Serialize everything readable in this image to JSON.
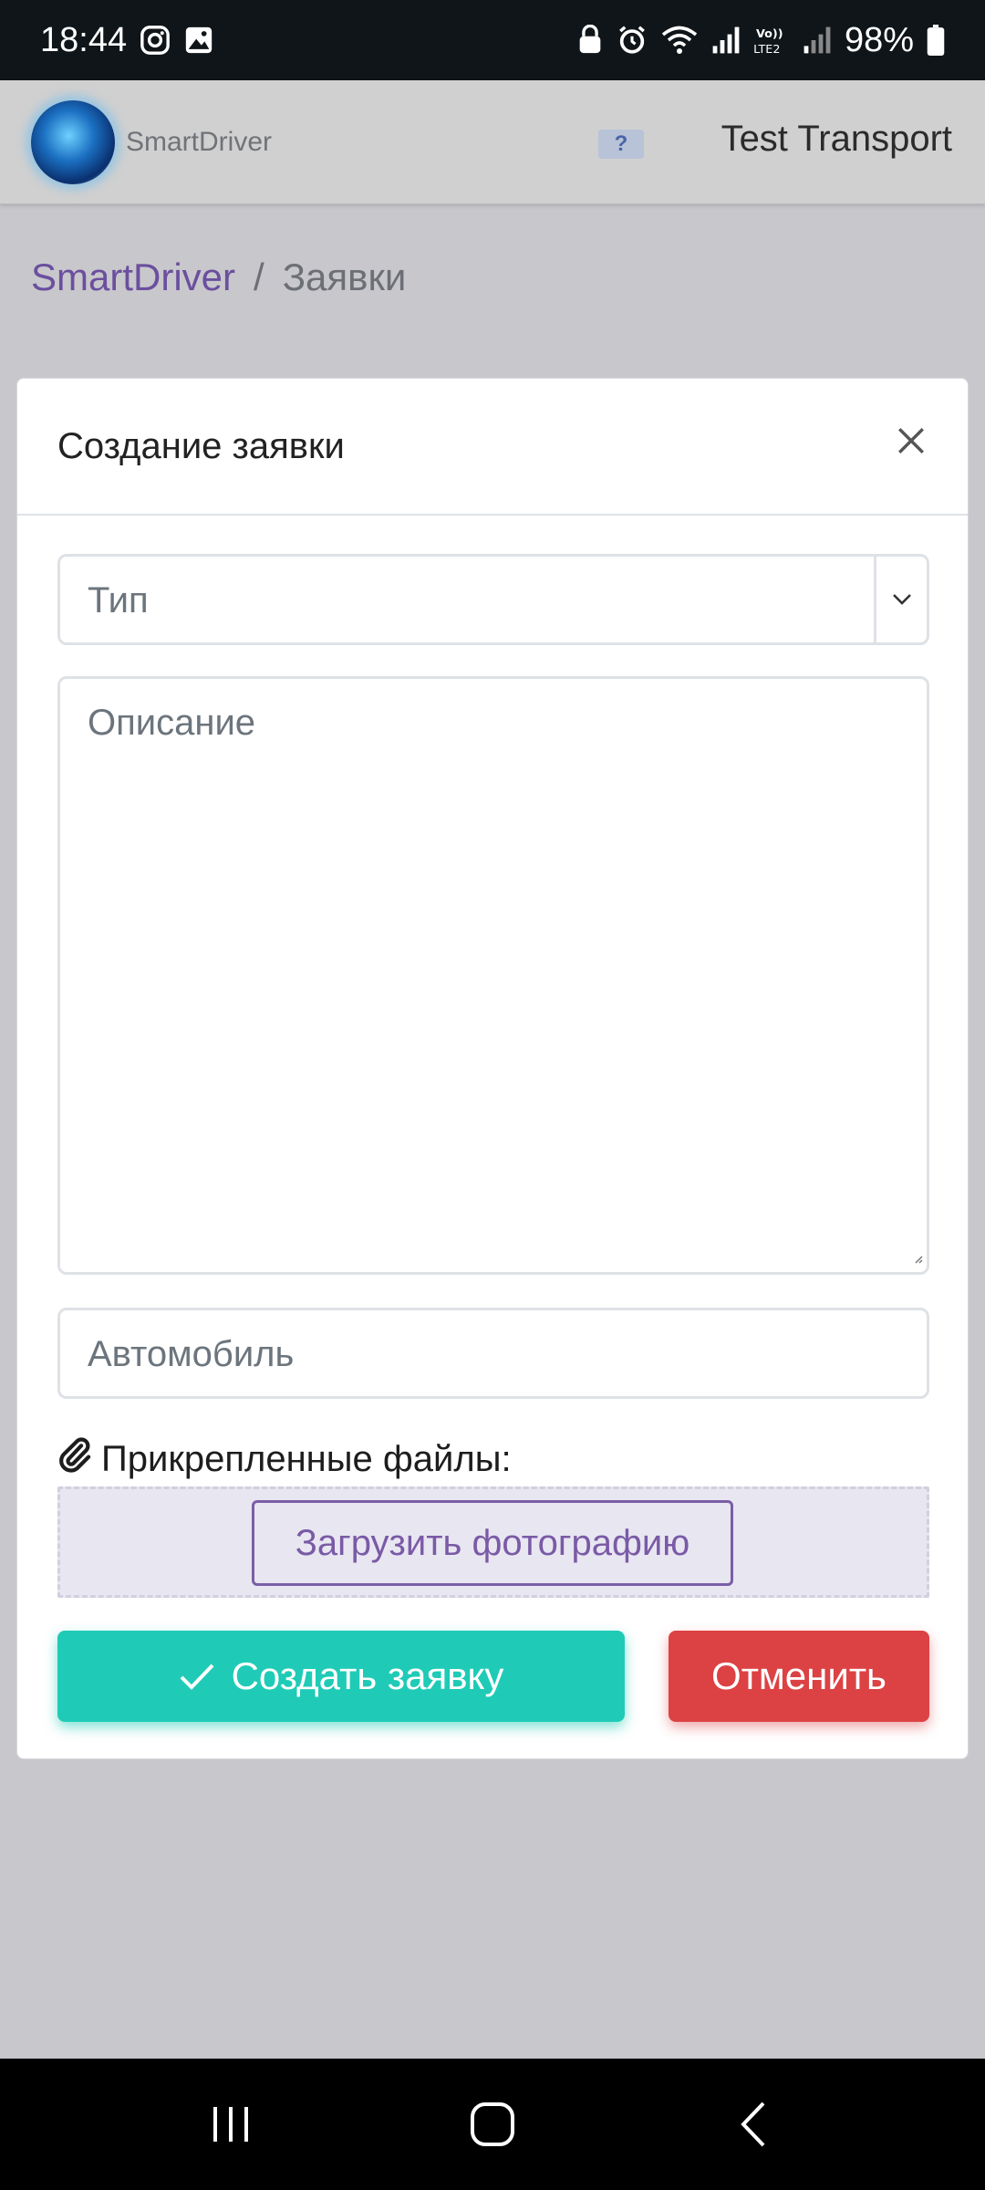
{
  "status_bar": {
    "time": "18:44",
    "battery": "98%",
    "icons": [
      "instagram-icon",
      "gallery-icon",
      "lock-icon",
      "alarm-icon",
      "wifi-icon",
      "signal-icon",
      "volte-icon",
      "signal-weak-icon",
      "battery-icon"
    ]
  },
  "app_bar": {
    "brand": "SmartDriver",
    "help": "?",
    "company": "Test Transport"
  },
  "breadcrumb": {
    "root": "SmartDriver",
    "separator": "/",
    "current": "Заявки"
  },
  "modal": {
    "title": "Создание заявки",
    "type_placeholder": "Тип",
    "description_placeholder": "Описание",
    "vehicle_placeholder": "Автомобиль",
    "attachments_label": "Прикрепленные файлы:",
    "upload_label": "Загрузить фотографию",
    "create_label": "Создать заявку",
    "cancel_label": "Отменить"
  },
  "colors": {
    "accent_purple": "#6b4f9e",
    "create_button": "#1fcbb6",
    "cancel_button": "#dc4244"
  }
}
